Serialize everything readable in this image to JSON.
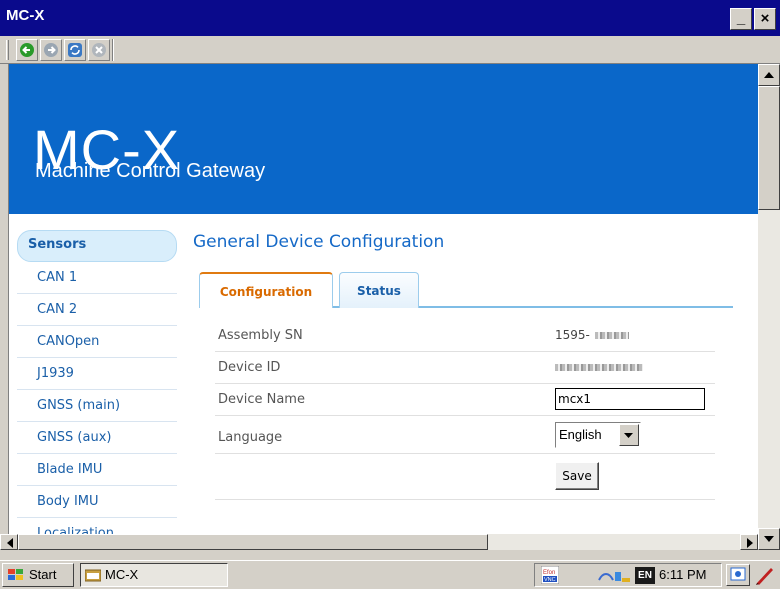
{
  "window": {
    "title": "MC-X",
    "minimize_label": "_",
    "close_label": "×"
  },
  "toolbar": {
    "back_icon": "back-arrow-icon",
    "forward_icon": "forward-arrow-icon",
    "refresh_icon": "refresh-icon",
    "stop_icon": "stop-icon"
  },
  "banner": {
    "title": "MC-X",
    "subtitle": "Machine Control Gateway",
    "bg_color": "#0a67c9"
  },
  "sidebar": {
    "items": [
      {
        "label": "Sensors"
      },
      {
        "label": "CAN 1"
      },
      {
        "label": "CAN 2"
      },
      {
        "label": "CANOpen"
      },
      {
        "label": "J1939"
      },
      {
        "label": "GNSS (main)"
      },
      {
        "label": "GNSS (aux)"
      },
      {
        "label": "Blade IMU"
      },
      {
        "label": "Body IMU"
      },
      {
        "label": "Localization"
      }
    ]
  },
  "main": {
    "title": "General Device Configuration",
    "tabs": [
      {
        "label": "Configuration"
      },
      {
        "label": "Status"
      }
    ],
    "form": {
      "assembly_sn_label": "Assembly SN",
      "assembly_sn_value": "1595-",
      "device_id_label": "Device ID",
      "device_name_label": "Device Name",
      "device_name_value": "mcx1",
      "language_label": "Language",
      "language_value": "English",
      "save_label": "Save"
    }
  },
  "taskbar": {
    "start_label": "Start",
    "task_label": "MC-X",
    "lang_indicator": "EN",
    "clock": "6:11 PM",
    "vnc_label": "Efon VNC"
  }
}
